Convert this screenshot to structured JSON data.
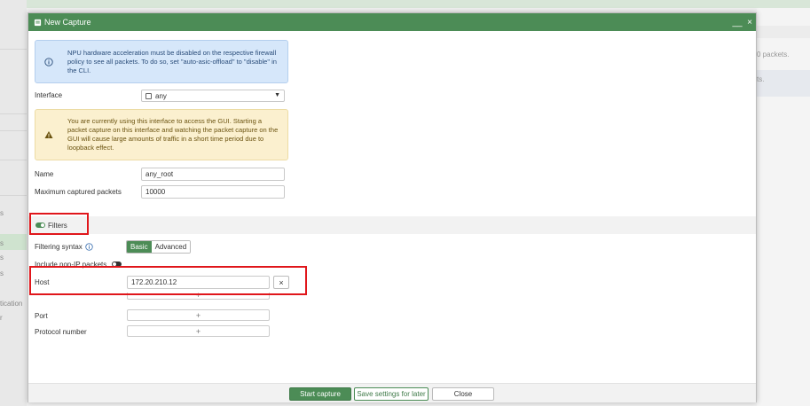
{
  "dialog": {
    "title": "New Capture",
    "title_icon": "capture-icon",
    "minimize_label": "__",
    "close_label": "×"
  },
  "info_alert": {
    "icon": "info-icon",
    "text": "NPU hardware acceleration must be disabled on the respective firewall policy to see all packets. To do so, set \"auto-asic-offload\" to \"disable\" in the CLI."
  },
  "interface": {
    "label": "Interface",
    "value": "any"
  },
  "warning_alert": {
    "icon": "warning-icon",
    "text": "You are currently using this interface to access the GUI. Starting a packet capture on this interface and watching the packet capture on the GUI will cause large amounts of traffic in a short time period due to loopback effect."
  },
  "name": {
    "label": "Name",
    "value": "any_root"
  },
  "max_packets": {
    "label": "Maximum captured packets",
    "value": "10000"
  },
  "filters": {
    "label": "Filters",
    "enabled": true,
    "syntax_label": "Filtering syntax",
    "syntax_options": [
      "Basic",
      "Advanced"
    ],
    "syntax_selected": "Basic",
    "non_ip_label": "Include non-IP packets",
    "non_ip_enabled": false,
    "host_label": "Host",
    "host_value": "172.20.210.12",
    "host_clear": "×",
    "add_symbol": "+",
    "port_label": "Port",
    "protocol_label": "Protocol number"
  },
  "footer": {
    "start_label": "Start capture",
    "save_label": "Save settings for later",
    "close_label": "Close"
  },
  "background": {
    "right_frag_1": "0 packets.",
    "right_frag_2": "ts.",
    "left_frags": [
      "s",
      "s",
      "s",
      "s",
      "tication",
      "r"
    ]
  },
  "colors": {
    "accent": "#4c8c56",
    "highlight": "#e0161b",
    "info_bg": "#d6e7fa",
    "warn_bg": "#fbf0cf"
  }
}
